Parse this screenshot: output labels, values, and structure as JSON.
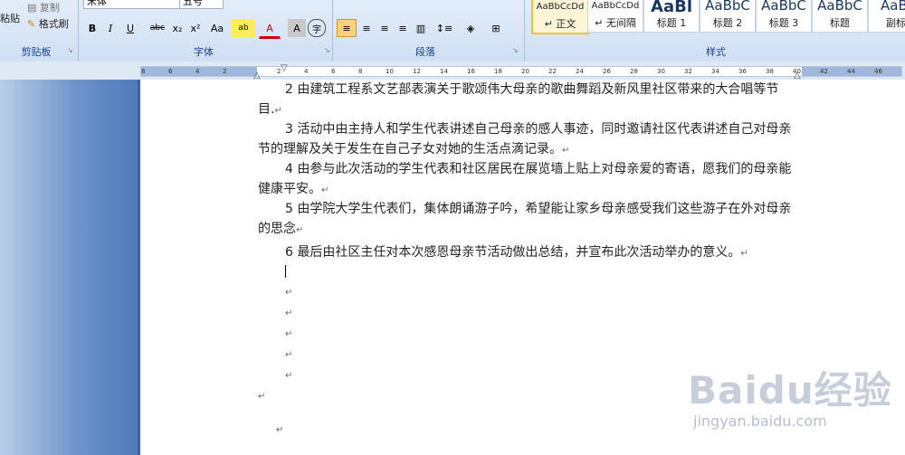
{
  "ribbon": {
    "clipboard": {
      "label": "剪贴板",
      "paste": "粘贴",
      "copy": "复制",
      "format_painter": "格式刷"
    },
    "font": {
      "label": "字体",
      "font_name": "宋体",
      "font_size": "五号",
      "bold": "B",
      "italic": "I",
      "underline": "U",
      "strike": "abc",
      "sub": "x₂",
      "sup": "x²",
      "case": "Aa",
      "highlight": "ab",
      "font_color": "A",
      "char_shade": "A",
      "enclose": "字"
    },
    "paragraph": {
      "label": "段落"
    },
    "styles": {
      "label": "样式",
      "tiles": [
        {
          "sample": "AaBbCcDd",
          "name": "↵ 正文"
        },
        {
          "sample": "AaBbCcDd",
          "name": "↵ 无间隔"
        },
        {
          "sample": "AaBl",
          "name": "标题 1"
        },
        {
          "sample": "AaBbC",
          "name": "标题 2"
        },
        {
          "sample": "AaBbC",
          "name": "标题 3"
        },
        {
          "sample": "AaBbC",
          "name": "标题"
        },
        {
          "sample": "AaBl",
          "name": "副标"
        }
      ]
    }
  },
  "ruler": {
    "ticks": [
      "8",
      "6",
      "4",
      "2",
      "",
      "2",
      "4",
      "6",
      "8",
      "10",
      "12",
      "14",
      "16",
      "18",
      "20",
      "22",
      "24",
      "26",
      "28",
      "30",
      "32",
      "34",
      "36",
      "38",
      "40",
      "42",
      "44",
      "46"
    ]
  },
  "document": {
    "paragraphs": [
      "2 由建筑工程系文艺部表演关于歌颂伟大母亲的歌曲舞蹈及新风里社区带来的大合唱等节目.",
      "3 活动中由主持人和学生代表讲述自己母亲的感人事迹，同时邀请社区代表讲述自己对母亲节的理解及关于发生在自己子女对她的生活点滴记录。",
      "4 由参与此次活动的学生代表和社区居民在展览墙上贴上对母亲爱的寄语，愿我们的母亲能健康平安。",
      "5 由学院大学生代表们，集体朗诵游子吟，希望能让家乡母亲感受我们这些游子在外对母亲的思念",
      "6 最后由社区主任对本次感恩母亲节活动做出总结，并宣布此次活动举办的意义。"
    ],
    "para_mark": "↵"
  },
  "watermark": {
    "logo": "Baidu经验",
    "url": "jingyan.baidu.com"
  }
}
